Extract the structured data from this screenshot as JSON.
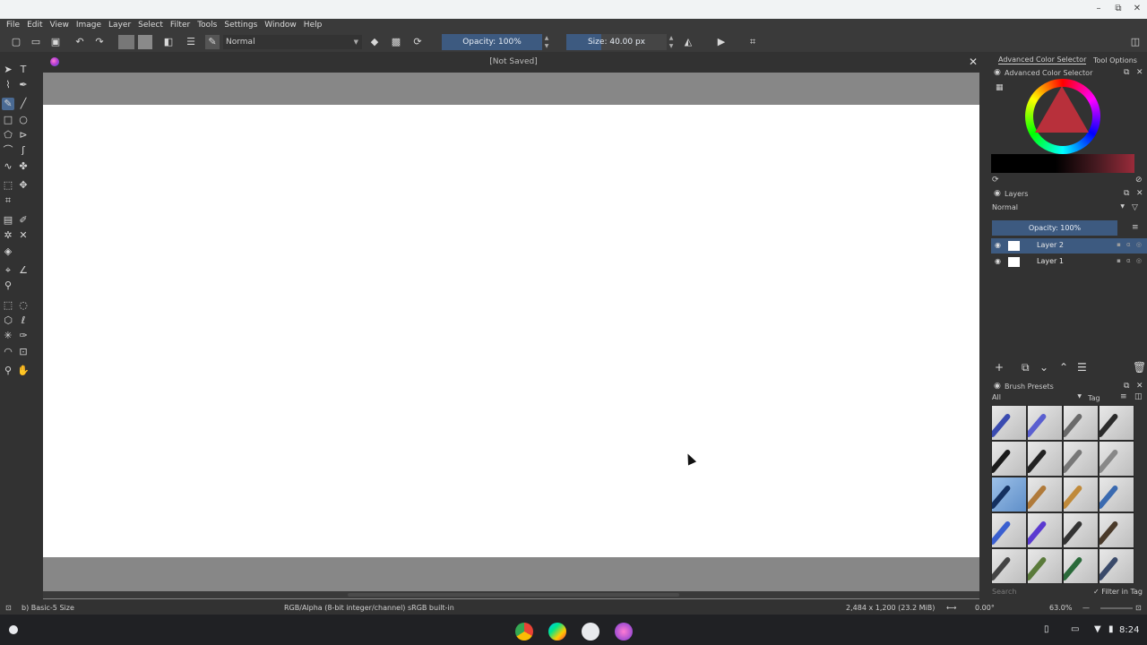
{
  "window": {
    "minimize_glyph": "–",
    "maximize_glyph": "⧉",
    "close_glyph": "✕"
  },
  "menubar": {
    "items": [
      "File",
      "Edit",
      "View",
      "Image",
      "Layer",
      "Select",
      "Filter",
      "Tools",
      "Settings",
      "Window",
      "Help"
    ]
  },
  "toolbar": {
    "blend_mode": "Normal",
    "opacity_label": "Opacity: 100%",
    "size_label": "Size: 40.00 px"
  },
  "document": {
    "title": "[Not Saved]",
    "close_glyph": "✕"
  },
  "dock": {
    "tab_active": "Advanced Color Selector",
    "tab_other": "Tool Options",
    "color_selector_title": "Advanced Color Selector",
    "layers_title": "Layers",
    "layers_blend": "Normal",
    "layers_opacity": "Opacity:  100%",
    "layers": [
      {
        "name": "Layer 2",
        "selected": true
      },
      {
        "name": "Layer 1",
        "selected": false
      }
    ],
    "presets_title": "Brush Presets",
    "presets_filter": "All",
    "presets_tag": "Tag",
    "presets_search_placeholder": "Search",
    "filter_in_tag": "Filter in Tag"
  },
  "statusbar": {
    "brush": "b) Basic-5 Size",
    "color_model": "RGB/Alpha (8-bit integer/channel)  sRGB built-in",
    "image_size": "2,484 x 1,200 (23.2 MiB)",
    "rotation": "0.00°",
    "zoom": "63.0%"
  },
  "shelf": {
    "time": "8:24",
    "apps": [
      "chrome-app",
      "play-store-app",
      "files-app",
      "krita-app"
    ]
  },
  "colors": {
    "accent": "#3d5a80",
    "canvas_bg": "#878787",
    "paper": "#ffffff"
  }
}
